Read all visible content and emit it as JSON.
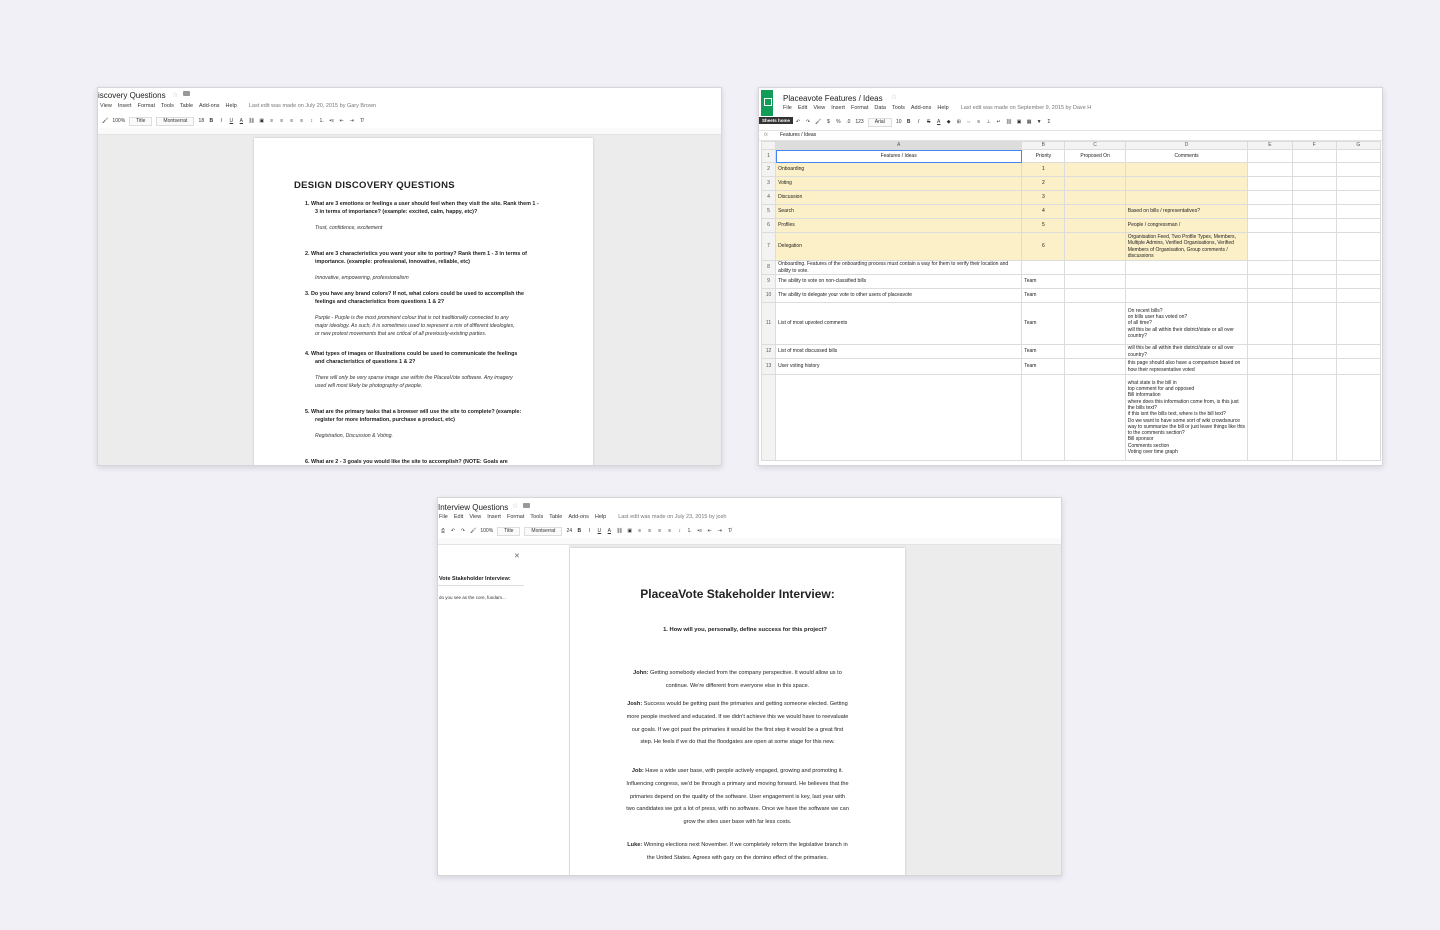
{
  "win1": {
    "title": "iscovery Questions",
    "menu": [
      "View",
      "Insert",
      "Format",
      "Tools",
      "Table",
      "Add-ons",
      "Help"
    ],
    "last_edit": "Last edit was made on July 20, 2015 by Gary Brown",
    "toolbar": {
      "zoom": "100%",
      "style": "Title",
      "font": "Montserrat",
      "size": "18"
    },
    "heading": "DESIGN DISCOVERY QUESTIONS",
    "items": [
      {
        "q1": "1.   What are 3 emotions or feelings a user should feel when they visit the site. Rank them 1 -",
        "q2": "3 in terms of importance? (example: excited, calm, happy, etc)?",
        "a": [
          "Trust, confidence, excitement"
        ]
      },
      {
        "q1": "2.   What are 3 characteristics you want your site to portray? Rank them 1 - 3 in terms of",
        "q2": "importance. (example: professional, innovative, reliable, etc)",
        "a": [
          "Innovative, empowering, professionalism"
        ]
      },
      {
        "q1": "3.    Do you have any brand colors? If not, what colors could be used to accomplish the",
        "q2": "feelings and characteristics from questions 1 & 2?",
        "a": [
          "Purple - Purple is the most prominent colour that is not traditionally connected to any",
          "major ideology. As such, it is sometimes used to represent a mix of different ideologies,",
          "or new protest movements that are critical of all previously-existing parties."
        ]
      },
      {
        "q1": "4.   What types of images or illustrations could be used to communicate the feelings",
        "q2": "and characteristics of questions 1 & 2?",
        "a": [
          "There will only be very sparse image use within the PlaceaVote software. Any imagery",
          "used will most likely be photography of people."
        ]
      },
      {
        "q1": "5.   What are the primary tasks that a browser will use the site to complete? (example:",
        "q2": "register for more information, purchase a product, etc)",
        "a": [
          "Registration, Discussion & Voting."
        ]
      },
      {
        "q1": "6.   What are 2 - 3 goals you would like the site to accomplish? (NOTE: Goals are",
        "q2": "",
        "a": []
      }
    ]
  },
  "win2": {
    "title": "Placeavote Features / Ideas",
    "menu": [
      "File",
      "Edit",
      "View",
      "Insert",
      "Format",
      "Data",
      "Tools",
      "Add-ons",
      "Help"
    ],
    "last_edit": "Last edit was made on September 9, 2015 by Dave H",
    "tooltip": "Sheets home",
    "toolbar": {
      "font": "Arial",
      "size": "10"
    },
    "formula": "Features / Ideas",
    "cols": [
      "A",
      "B",
      "C",
      "D",
      "E",
      "F",
      "G"
    ],
    "rows": [
      {
        "n": "1",
        "a": "Features / Ideas",
        "b": "Priority",
        "c": "Proposed On",
        "d": "Comments"
      },
      {
        "n": "2",
        "a": "Onboarding",
        "b": "1",
        "c": "",
        "d": ""
      },
      {
        "n": "3",
        "a": "Voting",
        "b": "2",
        "c": "",
        "d": ""
      },
      {
        "n": "4",
        "a": "Discussion",
        "b": "3",
        "c": "",
        "d": ""
      },
      {
        "n": "5",
        "a": "Search",
        "b": "4",
        "c": "",
        "d": "Based on bills / representatives?"
      },
      {
        "n": "6",
        "a": "Profiles",
        "b": "5",
        "c": "",
        "d": "People / congressman /"
      },
      {
        "n": "7",
        "a": "Delegation",
        "b": "6",
        "c": "",
        "d": "Organisation Feed, Two Profile Types, Members, Multiple Admins, Verified Organisations,  Verified Members of Organisation,  Group comments / discussions"
      },
      {
        "n": "8",
        "a": "Onboarding. Features of the onboarding process must contain a way for them to verify their location and ability to vote.",
        "b": "",
        "c": "",
        "d": ""
      },
      {
        "n": "9",
        "a": "The ability to vote on non-classified bills",
        "b": "Team",
        "c": "",
        "d": ""
      },
      {
        "n": "10",
        "a": "The ability to delegate your vote to other users of placeavote",
        "b": "Team",
        "c": "",
        "d": ""
      },
      {
        "n": "11",
        "a": "List of most upvoted comments",
        "b": "Team",
        "c": "",
        "d": "On recent bills?\non bills user has voted on?\nof all time?\nwill this be all within their district/state or all over country?"
      },
      {
        "n": "12",
        "a": "List of most discussed bills",
        "b": "Team",
        "c": "",
        "d": "will this be all within their district/state or all over country?"
      },
      {
        "n": "13",
        "a": "User voting history",
        "b": "Team",
        "c": "",
        "d": "this page should also have a comparison based on how their representative voted"
      },
      {
        "n": "",
        "a": "",
        "b": "",
        "c": "",
        "d": "what state is the bill in\ntop comment for and opposed\nBill information\nwhere does this information come from, is this just the bills text?\nif this isnt the bills text, where is the bill text?\nDo we want to have some sort of wiki crowdsource way to summarize the bill or just leave things like this to the comments section?\nBill sponsor\nComments section\nVoting over time graph"
      }
    ]
  },
  "win3": {
    "title": "Interview Questions",
    "menu": [
      "File",
      "Edit",
      "View",
      "Insert",
      "Format",
      "Tools",
      "Table",
      "Add-ons",
      "Help"
    ],
    "last_edit": "Last edit was made on July 23, 2015 by josh",
    "toolbar": {
      "zoom": "100%",
      "style": "Title",
      "font": "Montserrat",
      "size": "24"
    },
    "outline_title": "Vote Stakeholder Interview:",
    "outline_item": "do you see as the core, fundam...",
    "heading": "PlaceaVote Stakeholder Interview:",
    "question": "1.   How will you, personally, define success for this project?",
    "paras": [
      {
        "who": "John:",
        "lines": [
          "Getting somebody elected from the company perspective. It would allow us to",
          "continue. We're different from everyone else in this space."
        ]
      },
      {
        "who": "Josh:",
        "lines": [
          "Success would be getting past the primaries and getting someone elected. Getting",
          "more people involved and educated. If we didn't achieve this we would have to reevaluate",
          "our goals. If we got past the primaries it would be the first step it would be a great first",
          "step. He feels if we do that the floodgates are open at some stage for this new."
        ]
      },
      {
        "who": "Job:",
        "lines": [
          "Have a wide user base, with people actively engaged, growing and promoting it.",
          "Influencing congress, we'd be through a primary and moving forward. He believes that the",
          "primaries depend on the quality of the software. User engagement is key, last year with",
          "two candidates we got a lot of press, with no software. Once we have the software we can",
          "grow the sites user base with far less costs."
        ]
      },
      {
        "who": "Luke:",
        "lines": [
          "Winning elections next November. If we completely reform the legislative branch in",
          "the United States. Agrees with gary on the domino effect of the primaries."
        ]
      }
    ]
  }
}
